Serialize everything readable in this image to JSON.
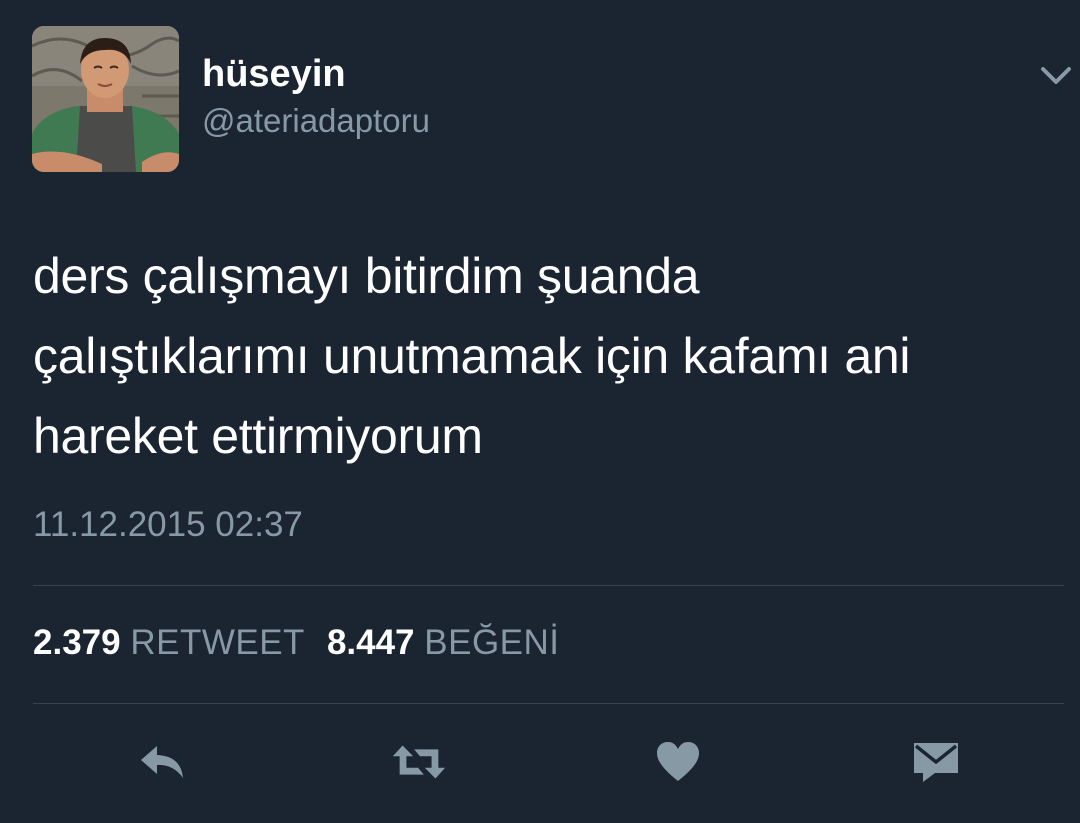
{
  "user": {
    "display_name": "hüseyin",
    "handle": "@ateriadaptoru",
    "avatar": "profile-photo"
  },
  "tweet": {
    "lines": [
      "ders çalışmayı bitirdim şuanda",
      "çalıştıklarımı unutmamak için kafamı ani",
      "hareket ettirmiyorum"
    ],
    "timestamp": "11.12.2015 02:37"
  },
  "stats": {
    "retweets": {
      "count": "2.379",
      "label": "RETWEET"
    },
    "likes": {
      "count": "8.447",
      "label": "BEĞENİ"
    }
  },
  "actions": [
    "reply-icon",
    "retweet-icon",
    "like-icon",
    "direct-message-icon"
  ],
  "colors": {
    "background": "#1b2431",
    "primary_text": "#ffffff",
    "secondary_text": "#8899a6",
    "icon": "#8899a6",
    "divider": "#38444d"
  }
}
